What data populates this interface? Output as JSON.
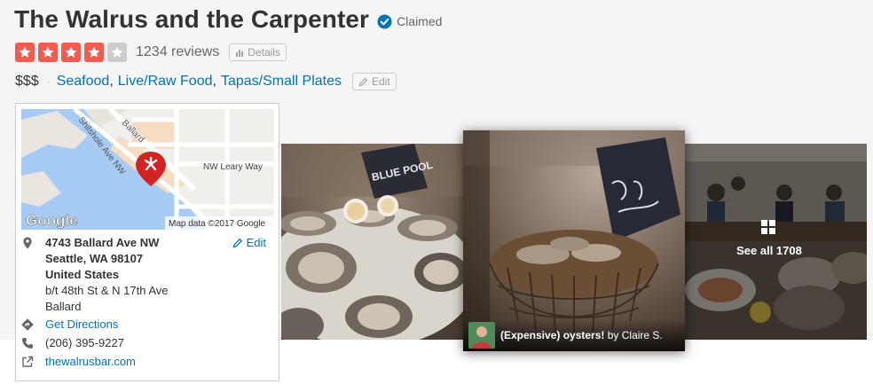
{
  "business": {
    "name": "The Walrus and the Carpenter",
    "claimed_label": "Claimed"
  },
  "rating": {
    "stars": 4,
    "max_stars": 5,
    "reviews_label": "1234 reviews",
    "details_label": "Details",
    "star_color": "#f15c4f",
    "empty_star_color": "#cccccc"
  },
  "categories": {
    "price": "$$$",
    "separator": "·",
    "items": [
      "Seafood",
      "Live/Raw Food",
      "Tapas/Small Plates"
    ],
    "edit_label": "Edit"
  },
  "map": {
    "street_labels": [
      "Shilshole Ave NW",
      "Ballard",
      "NW Leary Way"
    ],
    "attribution": "Map data ©2017 Google",
    "logo_text": "Google",
    "pin_icon": "yelp-burst-pin-icon"
  },
  "address": {
    "line1": "4743 Ballard Ave NW",
    "line2": "Seattle, WA 98107",
    "line3": "United States",
    "cross_streets": "b/t 48th St & N 17th Ave",
    "neighborhood": "Ballard",
    "edit_label": "Edit"
  },
  "contact": {
    "directions_label": "Get Directions",
    "phone": "(206) 395-9227",
    "website": "thewalrusbar.com"
  },
  "photos": {
    "caption_title": "(Expensive) oysters!",
    "caption_by": "by Claire S.",
    "see_all_label": "See all 1708",
    "sign_text": "BLUE POOL"
  },
  "colors": {
    "link": "#0073bb",
    "brand_red": "#d32323",
    "claimed_blue": "#0073bb"
  }
}
